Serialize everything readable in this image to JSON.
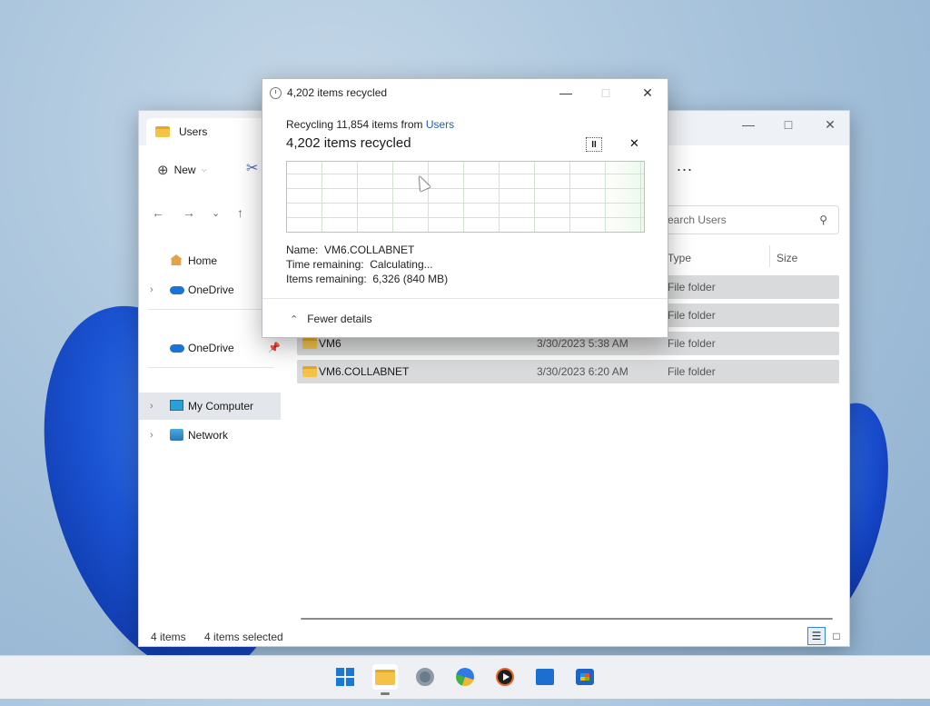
{
  "explorer": {
    "tab_title": "Users",
    "toolbar": {
      "new_label": "New",
      "more_label": "..."
    },
    "search_placeholder": "earch Users",
    "sidebar": {
      "home": "Home",
      "onedrive1": "OneDrive",
      "onedrive2": "OneDrive",
      "my_computer": "My Computer",
      "network": "Network"
    },
    "columns": {
      "type": "Type",
      "size": "Size"
    },
    "rows": [
      {
        "name": "",
        "date": "",
        "type": "File folder"
      },
      {
        "name": "",
        "date": "",
        "type": "File folder"
      },
      {
        "name": "VM6",
        "date": "3/30/2023 5:38 AM",
        "type": "File folder"
      },
      {
        "name": "VM6.COLLABNET",
        "date": "3/30/2023 6:20 AM",
        "type": "File folder"
      }
    ],
    "status": {
      "items": "4 items",
      "selected": "4 items selected"
    }
  },
  "dialog": {
    "title": "4,202 items recycled",
    "subtitle_prefix": "Recycling 11,854 items from ",
    "subtitle_link": "Users",
    "heading": "4,202 items recycled",
    "name_label": "Name:",
    "name_value": "VM6.COLLABNET",
    "time_label": "Time remaining:",
    "time_value": "Calculating...",
    "items_label": "Items remaining:",
    "items_value": "6,326 (840 MB)",
    "fewer_details": "Fewer details"
  },
  "icons": {
    "folder": "folder-icon",
    "home": "home-icon",
    "onedrive": "cloud-icon",
    "computer": "monitor-icon",
    "network": "network-icon",
    "search": "search-icon"
  },
  "colors": {
    "accent": "#1f5cc1",
    "selection": "#d9dadb"
  }
}
